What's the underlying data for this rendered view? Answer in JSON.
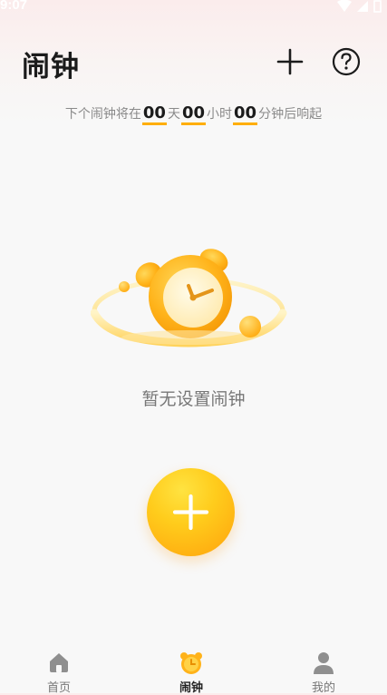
{
  "status_bar": {
    "time": "9:07"
  },
  "header": {
    "title": "闹钟"
  },
  "countdown": {
    "prefix": "下个闹钟将在",
    "days": "00",
    "days_unit": "天",
    "hours": "00",
    "hours_unit": "小时",
    "minutes": "00",
    "suffix": "分钟后响起"
  },
  "empty_state": {
    "message": "暂无设置闹钟"
  },
  "tabbar": {
    "tabs": [
      {
        "label": "首页",
        "icon": "home-icon",
        "active": false
      },
      {
        "label": "闹钟",
        "icon": "alarm-clock-icon",
        "active": true
      },
      {
        "label": "我的",
        "icon": "user-icon",
        "active": false
      }
    ]
  },
  "colors": {
    "accent": "#ffae00",
    "fab_top": "#ffe341",
    "fab_bottom": "#ffa20c"
  }
}
